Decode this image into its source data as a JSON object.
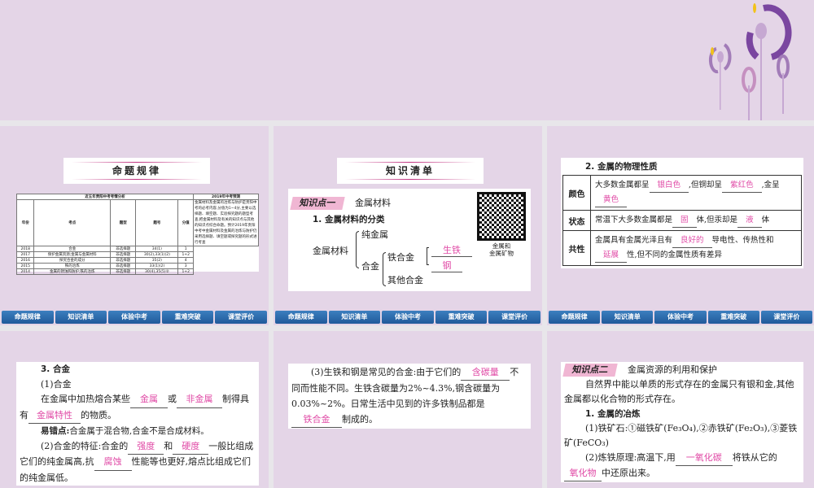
{
  "nav": [
    "命题规律",
    "知识清单",
    "体验中考",
    "重难突破",
    "课堂评价"
  ],
  "slide1": {
    "banner": "命题规律",
    "table_title": "近五年贵阳中考考情分析",
    "pred_title": "2019年中考预测",
    "headers": [
      "年份",
      "考点",
      "题型",
      "题号",
      "分值"
    ],
    "rows": [
      [
        "2018",
        "合金",
        "非选择题",
        "34(1)",
        "1"
      ],
      [
        "2017",
        "保护金属资源;金属与金属材料",
        "非选择题",
        "30(2),33(1)(2)",
        "1+2"
      ],
      [
        "2016",
        "探究合金的成分",
        "非选择题",
        "35(2)",
        "4"
      ],
      [
        "2015",
        "铁的冶炼",
        "非选择题",
        "33(1)(2)",
        "3"
      ],
      [
        "2014",
        "金属的锈蚀和防护;铁的冶炼",
        "非选择题",
        "30(4),35(5)②",
        "1+2"
      ]
    ],
    "prediction": "金属材料及金属的冶炼与防护是贵阳中考的必考内容,分值为1~4分,主要以选择题、填空题、实验探究题的题型考查,把金属材料及有关的知识点与其他的知识点综合命题。预计2019年贵阳中考中金属材料及金属的冶炼与防护仍采用选择题、填空题或探究题的形式进行考查"
  },
  "slide2": {
    "banner": "知识清单",
    "tag": "知识点一",
    "tag_title": "金属材料",
    "heading": "1. 金属材料的分类",
    "root": "金属材料",
    "pure": "纯金属",
    "alloy": "合金",
    "iron_alloy": "铁合金",
    "pig_iron": "生铁",
    "steel": "钢",
    "other_alloy": "其他合金",
    "qr_caption": "金属和\n金属矿物"
  },
  "slide3": {
    "heading": "2. 金属的物理性质",
    "rows": [
      {
        "label": "颜色",
        "t1": "大多数金属都呈",
        "a1": "银白色",
        "t2": ",但铜却呈",
        "a2": "紫红色",
        "t3": ",金呈",
        "a3": "黄色"
      },
      {
        "label": "状态",
        "t1": "常温下大多数金属都是",
        "a1": "固",
        "t2": "体,但汞却是",
        "a2": "液",
        "t3": "体"
      },
      {
        "label": "共性",
        "t1": "金属具有金属光泽且有",
        "a1": "良好的",
        "t2": "导电性、传热性和",
        "a2": "延展",
        "t3": "性,但不同的金属性质有差异"
      }
    ]
  },
  "slide4": {
    "heading": "3. 合金",
    "sub1": "(1)合金",
    "p1a": "在金属中加热熔合某些",
    "a1": "金属",
    "p1b": "或",
    "a2": "非金属",
    "p1c": "制得具有",
    "a3": "金属特性",
    "p1d": "的物质。",
    "err_label": "易错点:",
    "err": "合金属于混合物,合金不是合成材料。",
    "p2a": "(2)合金的特征:合金的",
    "a4": "强度",
    "p2b": "和",
    "a5": "硬度",
    "p2c": "一般比组成它们的纯金属高,抗",
    "a6": "腐蚀",
    "p2d": "性能等也更好,熔点比组成它们的纯金属低。"
  },
  "slide5": {
    "p1": "(3)生铁和钢是常见的合金:由于它们的",
    "a1": "含碳量",
    "p2": "不同而性能不同。生铁含碳量为2%~4.3%,钢含碳量为0.03%~2%。日常生活中见到的许多铁制品都是",
    "a2": "铁合金",
    "p3": "制成的。"
  },
  "slide6": {
    "tag": "知识点二",
    "tag_title": "金属资源的利用和保护",
    "p1": "自然界中能以单质的形式存在的金属只有银和金,其他金属都以化合物的形式存在。",
    "heading": "1. 金属的冶炼",
    "ore": "(1)铁矿石:①磁铁矿(Fe₃O₄),②赤铁矿(Fe₂O₃),③菱铁矿(FeCO₃)",
    "p2": "(2)炼铁原理:高温下,用",
    "a1": "一氧化碳",
    "p3": "将铁从它的",
    "a2": "氧化物",
    "p4": "中还原出来。"
  },
  "colors": {
    "answer": "#e04aa6",
    "nav": "#2d6eae",
    "bg": "#e4d5e7"
  }
}
